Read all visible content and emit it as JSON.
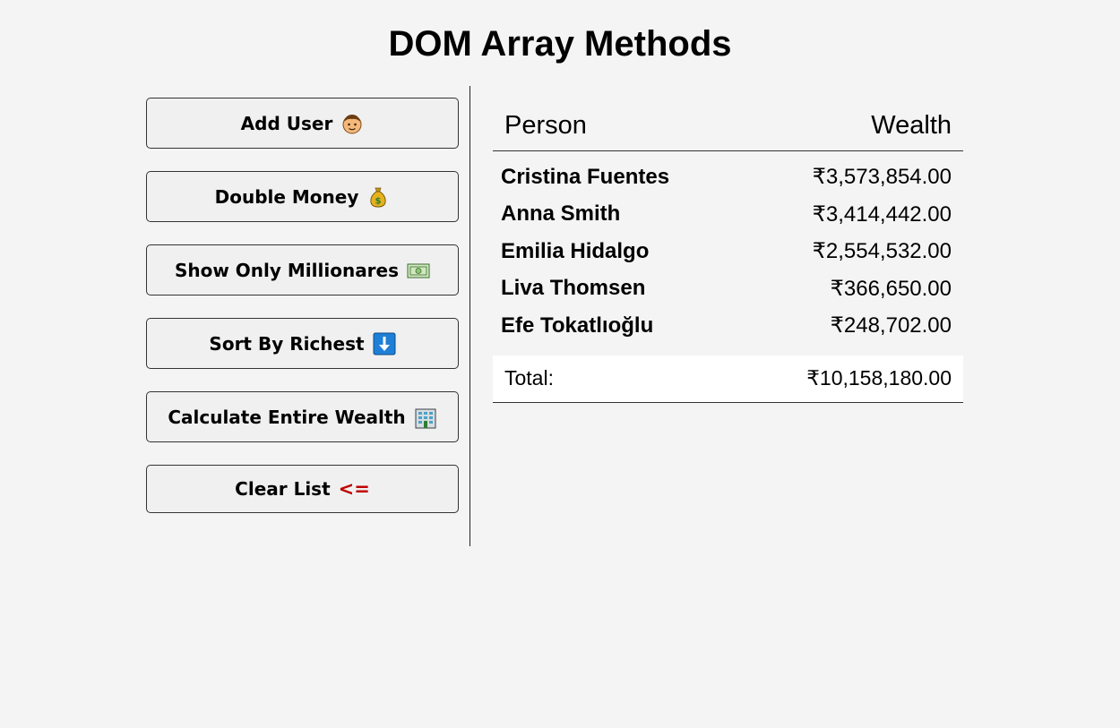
{
  "title": "DOM Array Methods",
  "buttons": {
    "add_user": {
      "label": "Add User",
      "icon": "man-face-icon"
    },
    "double_money": {
      "label": "Double Money",
      "icon": "money-bag-icon"
    },
    "show_millionaires": {
      "label": "Show Only Millionares",
      "icon": "dollar-banknote-icon"
    },
    "sort_richest": {
      "label": "Sort By Richest",
      "icon": "down-arrow-icon"
    },
    "calculate_wealth": {
      "label": "Calculate Entire Wealth",
      "icon": "bank-building-icon"
    },
    "clear_list": {
      "label": "Clear List",
      "suffix": "<="
    }
  },
  "table": {
    "headers": {
      "person": "Person",
      "wealth": "Wealth"
    },
    "rows": [
      {
        "name": "Cristina Fuentes",
        "wealth": "₹3,573,854.00"
      },
      {
        "name": "Anna Smith",
        "wealth": "₹3,414,442.00"
      },
      {
        "name": "Emilia Hidalgo",
        "wealth": "₹2,554,532.00"
      },
      {
        "name": "Liva Thomsen",
        "wealth": "₹366,650.00"
      },
      {
        "name": "Efe Tokatlıoğlu",
        "wealth": "₹248,702.00"
      }
    ],
    "total": {
      "label": "Total:",
      "value": "₹10,158,180.00"
    }
  },
  "colors": {
    "background": "#f4f4f5",
    "clear_arrow": "#c00000",
    "sort_icon_blue": "#1f7fd6",
    "money_bag": "#e6b21c"
  }
}
